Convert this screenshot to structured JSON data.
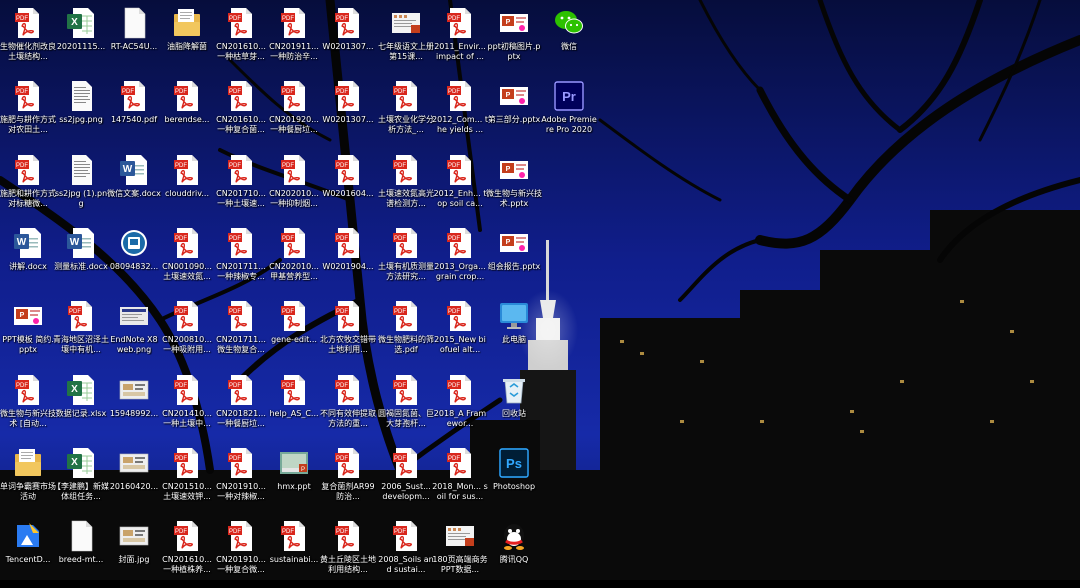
{
  "desktop": {
    "columns": [
      [
        {
          "label": "生物催化剂改良土壤结构...",
          "icon": "pdf-icon"
        },
        {
          "label": "施肥与耕作方式对农田土...",
          "icon": "pdf-icon"
        },
        {
          "label": "施肥和耕作方式对标糖微...",
          "icon": "pdf-icon"
        },
        {
          "label": "讲解.docx",
          "icon": "word-icon"
        },
        {
          "label": "PPT模板 简约.pptx",
          "icon": "ppt-icon"
        },
        {
          "label": "微生物与新兴技术 [自动...",
          "icon": "pdf-icon"
        },
        {
          "label": "单词争霸赛市场活动",
          "icon": "folder-doc-icon"
        },
        {
          "label": "TencentD...",
          "icon": "tencent-docs-icon"
        }
      ],
      [
        {
          "label": "20201115...",
          "icon": "excel-icon"
        },
        {
          "label": "ss2jpg.png",
          "icon": "image-doc-icon"
        },
        {
          "label": "ss2jpg (1).png",
          "icon": "image-doc-icon"
        },
        {
          "label": "测量标准.docx",
          "icon": "word-icon"
        },
        {
          "label": "青海地区沼泽土壤中有机...",
          "icon": "pdf-icon"
        },
        {
          "label": "数据记录.xlsx",
          "icon": "excel-icon"
        },
        {
          "label": "【李建鹏】新媒体组任务...",
          "icon": "excel-icon"
        },
        {
          "label": "breed-mt...",
          "icon": "blank-file-icon"
        }
      ],
      [
        {
          "label": "RT-AC54U...",
          "icon": "blank-file-icon"
        },
        {
          "label": "147540.pdf",
          "icon": "pdf-icon"
        },
        {
          "label": "微信文案.docx",
          "icon": "word-icon"
        },
        {
          "label": "08094832...",
          "icon": "network-icon"
        },
        {
          "label": "EndNote X8 web.png",
          "icon": "endnote-icon"
        },
        {
          "label": "15948992...",
          "icon": "image-icon"
        },
        {
          "label": "20160420...",
          "icon": "image-icon"
        },
        {
          "label": "封面.jpg",
          "icon": "image-icon"
        }
      ],
      [
        {
          "label": "油脂降解菌",
          "icon": "folder-doc-icon"
        },
        {
          "label": "berendse...",
          "icon": "pdf-icon"
        },
        {
          "label": "clouddriv...",
          "icon": "pdf-icon"
        },
        {
          "label": "CN001090... 土壤速效氮...",
          "icon": "pdf-icon"
        },
        {
          "label": "CN200810... 一种吸附用...",
          "icon": "pdf-icon"
        },
        {
          "label": "CN201410... 一种土壤中...",
          "icon": "pdf-icon"
        },
        {
          "label": "CN201510... 土壤速效钾...",
          "icon": "pdf-icon"
        },
        {
          "label": "CN201610... 一种植株养...",
          "icon": "pdf-icon"
        }
      ],
      [
        {
          "label": "CN201610... 一种枯草芽...",
          "icon": "pdf-icon"
        },
        {
          "label": "CN201610... 一种复合菌...",
          "icon": "pdf-icon"
        },
        {
          "label": "CN201710... 一种土壤速...",
          "icon": "pdf-icon"
        },
        {
          "label": "CN201711... 一种辣椒专...",
          "icon": "pdf-icon"
        },
        {
          "label": "CN201711... 微生物复合...",
          "icon": "pdf-icon"
        },
        {
          "label": "CN201821... 一种餐厨垃...",
          "icon": "pdf-icon"
        },
        {
          "label": "CN201910... 一种对辣椒...",
          "icon": "pdf-icon"
        },
        {
          "label": "CN201910... 一种复合微...",
          "icon": "pdf-icon"
        }
      ],
      [
        {
          "label": "CN201911... 一种防治辛...",
          "icon": "pdf-icon"
        },
        {
          "label": "CN201920... 一种餐厨垃...",
          "icon": "pdf-icon"
        },
        {
          "label": "CN202010... 一种抑制烟...",
          "icon": "pdf-icon"
        },
        {
          "label": "CN202010... 甲基营养型...",
          "icon": "pdf-icon"
        },
        {
          "label": "gene-edit...",
          "icon": "pdf-icon"
        },
        {
          "label": "help_AS_C...",
          "icon": "pdf-icon"
        },
        {
          "label": "hmx.ppt",
          "icon": "ppt-image-icon"
        },
        {
          "label": "sustainabi...",
          "icon": "pdf-icon"
        }
      ],
      [
        {
          "label": "W0201307...",
          "icon": "pdf-icon"
        },
        {
          "label": "W0201307...",
          "icon": "pdf-icon"
        },
        {
          "label": "W0201604...",
          "icon": "pdf-icon"
        },
        {
          "label": "W0201904...",
          "icon": "pdf-icon"
        },
        {
          "label": "北方农牧交错带土地利用...",
          "icon": "pdf-icon"
        },
        {
          "label": "不同有效伸提取方法的重...",
          "icon": "pdf-icon"
        },
        {
          "label": "复合菌剂AR99防治...",
          "icon": "pdf-icon"
        },
        {
          "label": "黄土丘陵区土地利用结构...",
          "icon": "pdf-icon"
        }
      ],
      [
        {
          "label": "七年级语文上册 第15课...",
          "icon": "doc-image-icon"
        },
        {
          "label": "土壤农业化学分析方法_...",
          "icon": "pdf-icon"
        },
        {
          "label": "土壤速效氮高光谱检测方...",
          "icon": "pdf-icon"
        },
        {
          "label": "土壤有机质测量方法研究...",
          "icon": "pdf-icon"
        },
        {
          "label": "微生物肥料的筛选.pdf",
          "icon": "pdf-icon"
        },
        {
          "label": "圆褐固氮菌、巨大芽孢杆...",
          "icon": "pdf-icon"
        },
        {
          "label": "2006_Sust... developm...",
          "icon": "pdf-icon"
        },
        {
          "label": "2008_Soils and sustai...",
          "icon": "pdf-icon"
        }
      ],
      [
        {
          "label": "2011_Envir... impact of ...",
          "icon": "pdf-icon"
        },
        {
          "label": "2012_Com... the yields ...",
          "icon": "pdf-icon"
        },
        {
          "label": "2012_Enh... top soil ca...",
          "icon": "pdf-icon"
        },
        {
          "label": "2013_Orga... grain crop...",
          "icon": "pdf-icon"
        },
        {
          "label": "2015_New biofuel alt...",
          "icon": "pdf-icon"
        },
        {
          "label": "2018_A Framewor...",
          "icon": "pdf-icon"
        },
        {
          "label": "2018_Mon... soil for sus...",
          "icon": "pdf-icon"
        },
        {
          "label": "180页高端商务PPT数据...",
          "icon": "doc-image-icon"
        }
      ],
      [
        {
          "label": "ppt初稿图片.pptx",
          "icon": "ppt-icon"
        },
        {
          "label": "第三部分.pptx",
          "icon": "ppt-icon"
        },
        {
          "label": "微生物与新兴技术.pptx",
          "icon": "ppt-icon"
        },
        {
          "label": "组会报告.pptx",
          "icon": "ppt-icon"
        },
        {
          "label": "此电脑",
          "icon": "this-pc-icon"
        },
        {
          "label": "回收站",
          "icon": "recycle-bin-icon"
        },
        {
          "label": "Photoshop",
          "icon": "photoshop-icon"
        },
        {
          "label": "腾讯QQ",
          "icon": "qq-icon"
        }
      ],
      [
        {
          "label": "微信",
          "icon": "wechat-icon"
        },
        {
          "label": "Adobe Premiere Pro 2020",
          "icon": "premiere-icon"
        }
      ]
    ]
  }
}
